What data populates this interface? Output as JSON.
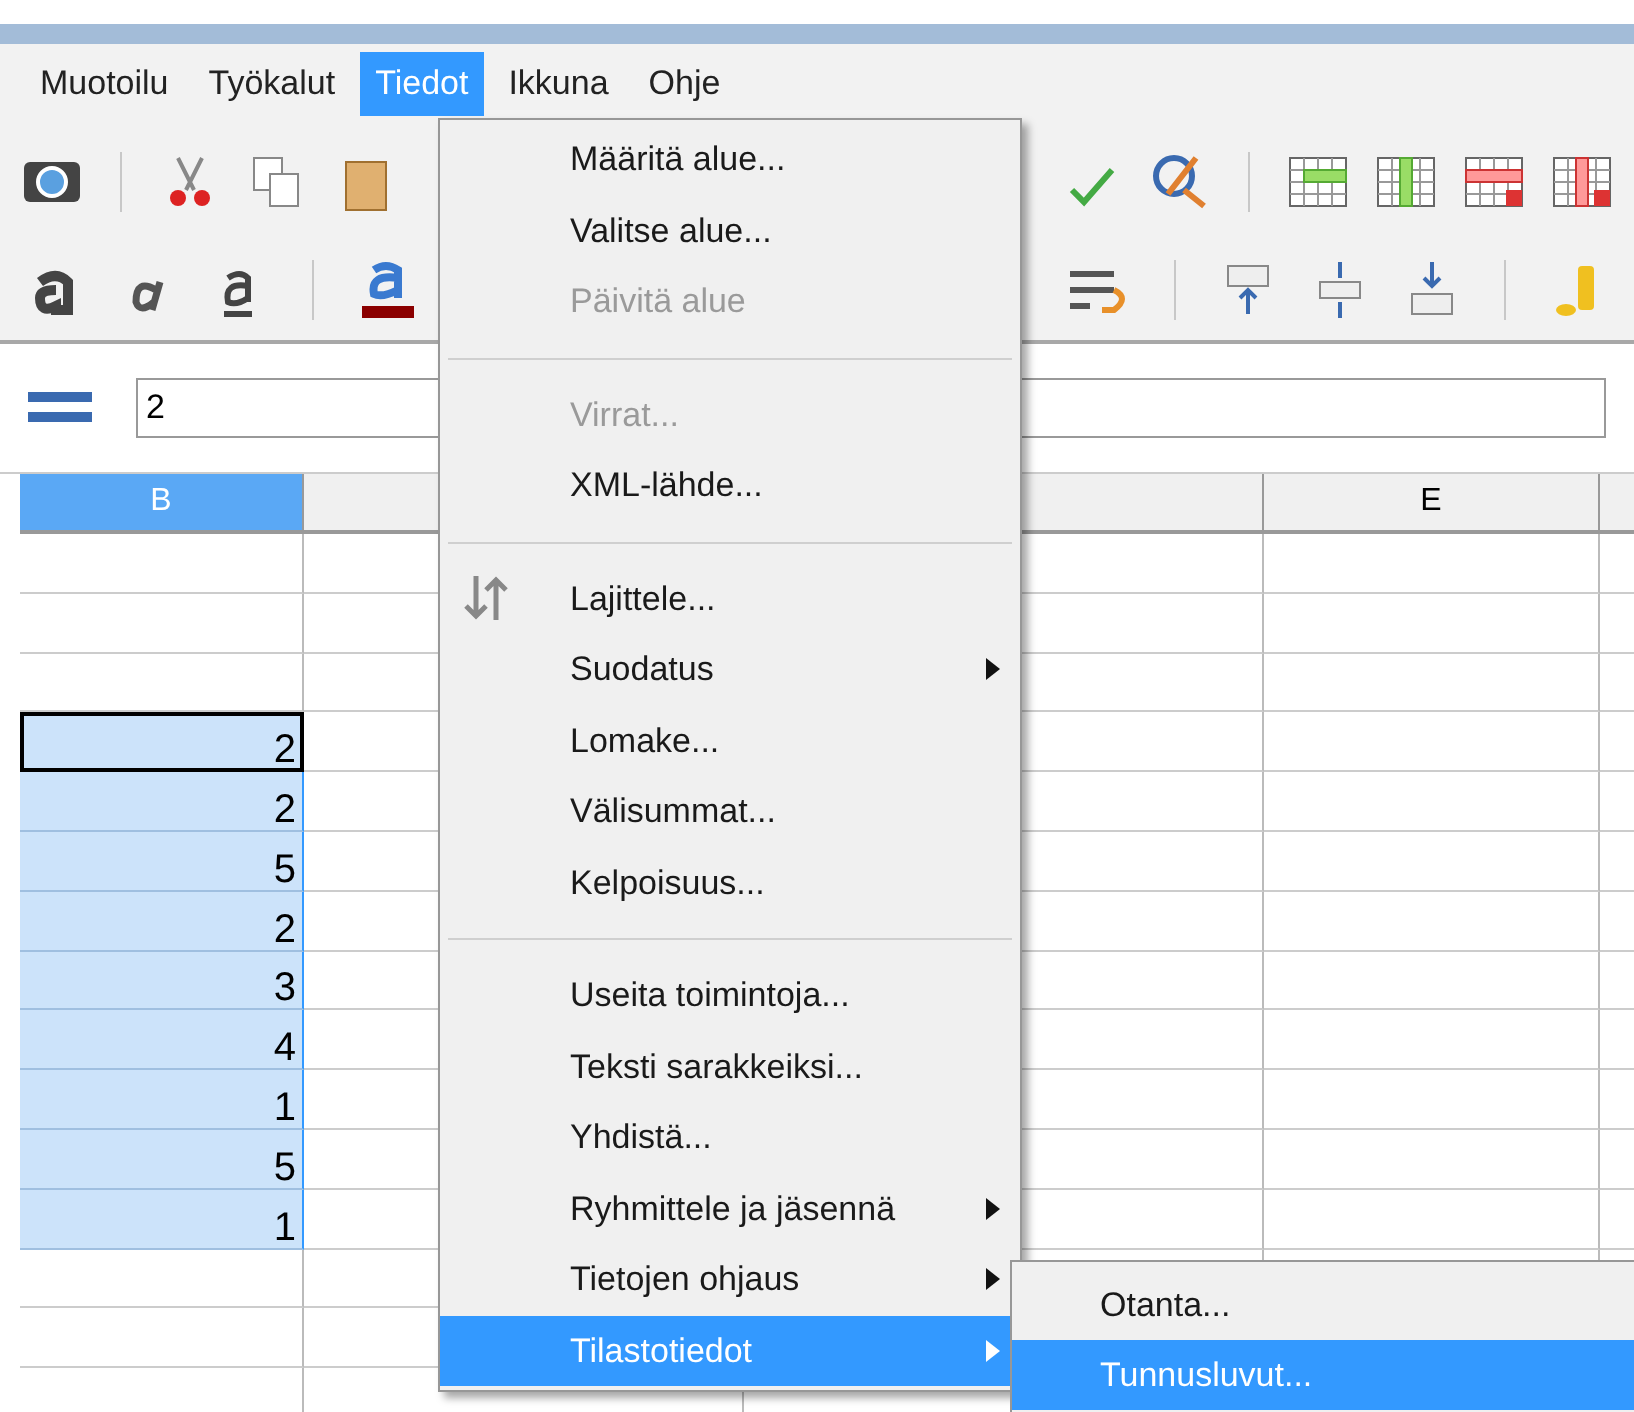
{
  "menubar": [
    {
      "label": "Muotoilu",
      "selected": false
    },
    {
      "label": "Työkalut",
      "selected": false
    },
    {
      "label": "Tiedot",
      "selected": true
    },
    {
      "label": "Ikkuna",
      "selected": false
    },
    {
      "label": "Ohje",
      "selected": false
    }
  ],
  "formula_bar": {
    "value": "2"
  },
  "columns": [
    {
      "label": "B",
      "selected": true
    },
    {
      "selected": false
    },
    {
      "selected": false
    },
    {
      "label": "E",
      "selected": false
    },
    {
      "selected": false
    }
  ],
  "rows": [
    {
      "selected": false
    },
    {
      "selected": false
    },
    {
      "selected": false
    },
    {
      "b": "2",
      "selected": true,
      "active": true
    },
    {
      "b": "2",
      "selected": true,
      "active": false
    },
    {
      "b": "5",
      "selected": true,
      "active": false
    },
    {
      "b": "2",
      "selected": true,
      "active": false
    },
    {
      "b": "3",
      "selected": true,
      "active": false
    },
    {
      "b": "4",
      "selected": true,
      "active": false
    },
    {
      "b": "1",
      "selected": true,
      "active": false
    },
    {
      "b": "5",
      "selected": true,
      "active": false
    },
    {
      "b": "1",
      "selected": true,
      "active": false
    },
    {
      "selected": false
    },
    {
      "selected": false
    },
    {
      "selected": false
    }
  ],
  "menu": {
    "items": [
      {
        "kind": "item",
        "label": "Määritä alue...",
        "disabled": false,
        "submenu": false,
        "selected": false
      },
      {
        "kind": "item",
        "label": "Valitse alue...",
        "disabled": false,
        "submenu": false,
        "selected": false
      },
      {
        "kind": "item",
        "label": "Päivitä alue",
        "disabled": true,
        "submenu": false,
        "selected": false
      },
      {
        "kind": "separator"
      },
      {
        "kind": "item",
        "label": "Virrat...",
        "disabled": true,
        "submenu": false,
        "selected": false
      },
      {
        "kind": "item",
        "label": "XML-lähde...",
        "disabled": false,
        "submenu": false,
        "selected": false
      },
      {
        "kind": "separator"
      },
      {
        "kind": "item",
        "label": "Lajittele...",
        "disabled": false,
        "submenu": false,
        "selected": false,
        "has_icon": true
      },
      {
        "kind": "item",
        "label": "Suodatus",
        "disabled": false,
        "submenu": true,
        "selected": false
      },
      {
        "kind": "item",
        "label": "Lomake...",
        "disabled": false,
        "submenu": false,
        "selected": false
      },
      {
        "kind": "item",
        "label": "Välisummat...",
        "disabled": false,
        "submenu": false,
        "selected": false
      },
      {
        "kind": "item",
        "label": "Kelpoisuus...",
        "disabled": false,
        "submenu": false,
        "selected": false
      },
      {
        "kind": "separator"
      },
      {
        "kind": "item",
        "label": "Useita toimintoja...",
        "disabled": false,
        "submenu": false,
        "selected": false
      },
      {
        "kind": "item",
        "label": "Teksti sarakkeiksi...",
        "disabled": false,
        "submenu": false,
        "selected": false
      },
      {
        "kind": "item",
        "label": "Yhdistä...",
        "disabled": false,
        "submenu": false,
        "selected": false
      },
      {
        "kind": "item",
        "label": "Ryhmittele ja jäsennä",
        "disabled": false,
        "submenu": true,
        "selected": false
      },
      {
        "kind": "item",
        "label": "Tietojen ohjaus",
        "disabled": false,
        "submenu": true,
        "selected": false
      },
      {
        "kind": "item",
        "label": "Tilastotiedot",
        "disabled": false,
        "submenu": true,
        "selected": true
      }
    ]
  },
  "submenu": {
    "items": [
      {
        "label": "Otanta...",
        "selected": false
      },
      {
        "label": "Tunnusluvut...",
        "selected": true
      }
    ]
  }
}
